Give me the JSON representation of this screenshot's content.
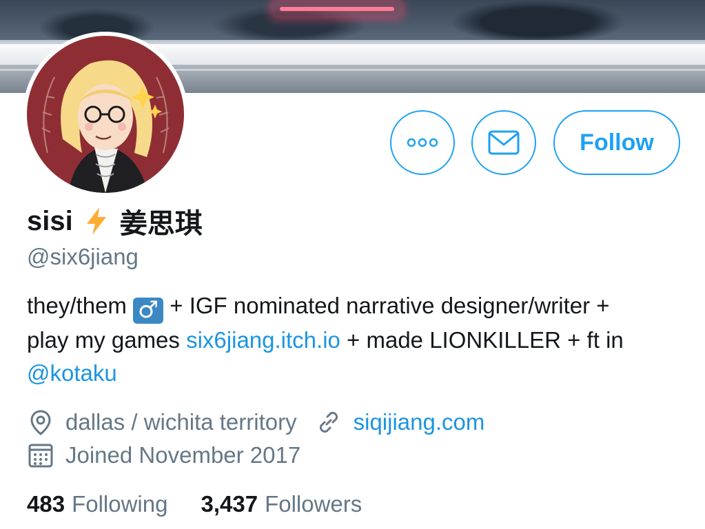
{
  "profile": {
    "display_name": "sisi",
    "display_name_emoji": "lightning-bolt",
    "display_name_suffix": "姜思琪",
    "handle": "@six6jiang"
  },
  "actions": {
    "more_icon": "more-horizontal-icon",
    "message_icon": "envelope-icon",
    "follow_label": "Follow"
  },
  "bio": {
    "line1_a": "they/them",
    "badge_symbol": "♂",
    "line1_b": " + IGF nominated narrative designer/writer +",
    "line2_a": "play my games ",
    "itch_link": "six6jiang.itch.io",
    "line2_b": " + made LIONKILLER + ft in",
    "mention": "@kotaku"
  },
  "meta": {
    "location": "dallas / wichita territory",
    "website": "siqijiang.com",
    "joined": "Joined November 2017"
  },
  "stats": {
    "following_count": "483",
    "following_label": "Following",
    "followers_count": "3,437",
    "followers_label": "Followers"
  },
  "colors": {
    "accent": "#1da1f2",
    "link": "#1b95e0",
    "muted": "#657786",
    "text": "#14171a",
    "badge": "#3b88c3",
    "bolt": "#ffac33",
    "avatar_bg": "#8e2e34"
  }
}
